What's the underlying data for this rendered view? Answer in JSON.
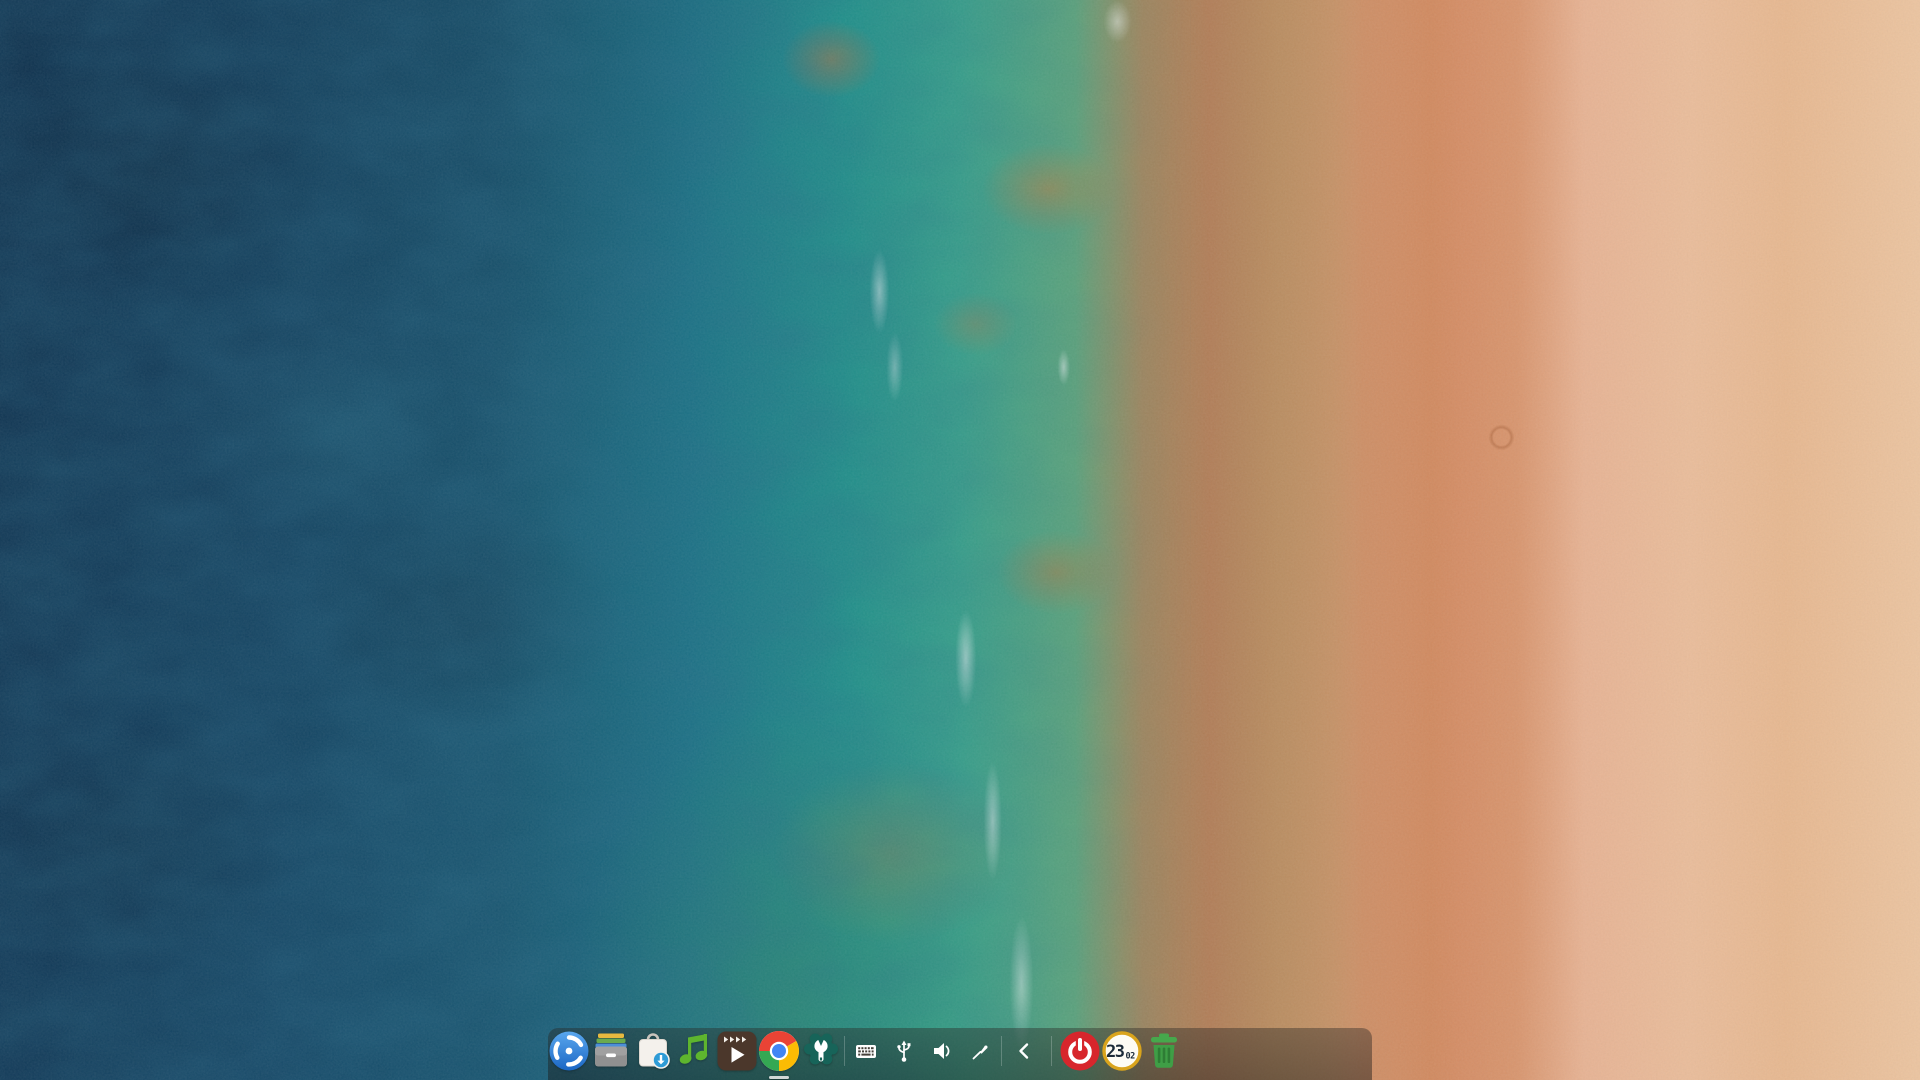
{
  "wallpaper": {
    "description": "aerial beach: deep blue ocean, turquoise shallows, red surf line, peach sand",
    "colors": {
      "deep_ocean": "#0c3758",
      "teal_water": "#1b9089",
      "shallow_green": "#5aa37a",
      "surf_red": "#d65842",
      "wet_sand": "#cf8f66",
      "dry_sand": "#ecbd9a"
    }
  },
  "dock": {
    "background": "rgba(30,28,26,0.42)",
    "apps": [
      {
        "name": "Launcher",
        "icon": "deepin-launcher-icon",
        "color": "#2f7fd6",
        "running": false
      },
      {
        "name": "File Manager",
        "icon": "file-manager-icon",
        "color": "#9b9b9b",
        "running": false
      },
      {
        "name": "App Store",
        "icon": "app-store-icon",
        "color": "#2e9bd6",
        "running": false
      },
      {
        "name": "Music",
        "icon": "music-icon",
        "color": "#5eb52e",
        "running": false
      },
      {
        "name": "Movies",
        "icon": "movie-icon",
        "color": "#4b372b",
        "running": false
      },
      {
        "name": "Google Chrome",
        "icon": "chrome-icon",
        "color": "#4285f4",
        "running": true
      },
      {
        "name": "Control Center",
        "icon": "control-center-icon",
        "color": "#176459",
        "running": false
      }
    ],
    "tray": [
      {
        "name": "Keyboard Layout",
        "icon": "keyboard-icon"
      },
      {
        "name": "USB Device",
        "icon": "usb-icon"
      },
      {
        "name": "Volume",
        "icon": "volume-icon"
      },
      {
        "name": "Pen Input",
        "icon": "brush-icon"
      }
    ],
    "collapse": {
      "name": "Collapse Tray",
      "icon": "chevron-left-icon"
    },
    "system": [
      {
        "name": "Shut Down",
        "icon": "power-icon",
        "color": "#d7262c"
      },
      {
        "name": "Clock",
        "icon": "clock-icon",
        "ring_color": "#d9a41c"
      },
      {
        "name": "Trash",
        "icon": "trash-icon",
        "color": "#3f9e46"
      }
    ],
    "clock": {
      "hours": "23",
      "minutes": "02"
    }
  }
}
